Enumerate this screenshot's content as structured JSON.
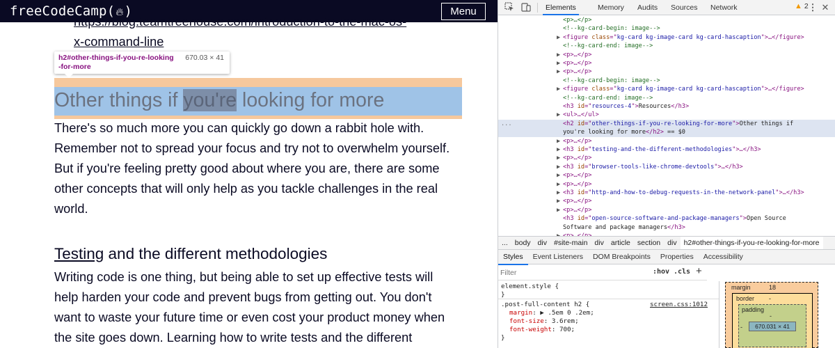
{
  "page": {
    "logo": "freeCodeCamp",
    "logo_paren_open": "(",
    "logo_paren_close": ")",
    "menu_label": "Menu",
    "link_line1": "https://blog.teamtreehouse.com/introduction-to-the-mac-os-",
    "link_line2": "x-command-line",
    "tooltip": {
      "selector_line1": "h2#other-things-if-you-re-looking",
      "selector_line2": "-for-more",
      "dimensions": "670.03 × 41"
    },
    "heading_before": "Other things if ",
    "heading_selected": "you're",
    "heading_after": " looking for more",
    "paragraph1": "There's so much more you can quickly go down a rabbit hole with. Remember not to spread your focus and try not to overwhelm yourself. But if you're feeling pretty good about where you are, there are some other concepts that will only help as you tackle challenges in the real world.",
    "subheading_link": "Testing",
    "subheading_rest": " and the different methodologies",
    "paragraph2": "Writing code is one thing, but being able to set up effective tests will help harden your code and prevent bugs from getting out. You don't want to waste your future time or even cost your product money when the site goes down. Learning how to write tests and the different"
  },
  "devtools": {
    "tabs": [
      "Elements",
      "Memory",
      "Audits",
      "Sources",
      "Network"
    ],
    "active_tab": "Elements",
    "warning_count": "2",
    "dom_lines": [
      {
        "indent": 2,
        "tri": "",
        "parts": [
          [
            "cm",
            "<p>…</p>"
          ]
        ]
      },
      {
        "indent": 2,
        "tri": "",
        "parts": [
          [
            "cm",
            "<!--kg-card-begin: image-->"
          ]
        ]
      },
      {
        "indent": 2,
        "tri": "▶",
        "parts": [
          [
            "tg",
            "<figure "
          ],
          [
            "at",
            "class"
          ],
          [
            "tg",
            "=\""
          ],
          [
            "av",
            "kg-card kg-image-card kg-card-hascaption"
          ],
          [
            "tg",
            "\">…</figure>"
          ]
        ]
      },
      {
        "indent": 2,
        "tri": "",
        "parts": [
          [
            "cm",
            "<!--kg-card-end: image-->"
          ]
        ]
      },
      {
        "indent": 2,
        "tri": "▶",
        "parts": [
          [
            "tg",
            "<p>…</p>"
          ]
        ]
      },
      {
        "indent": 2,
        "tri": "▶",
        "parts": [
          [
            "tg",
            "<p>…</p>"
          ]
        ]
      },
      {
        "indent": 2,
        "tri": "▶",
        "parts": [
          [
            "tg",
            "<p>…</p>"
          ]
        ]
      },
      {
        "indent": 2,
        "tri": "",
        "parts": [
          [
            "cm",
            "<!--kg-card-begin: image-->"
          ]
        ]
      },
      {
        "indent": 2,
        "tri": "▶",
        "parts": [
          [
            "tg",
            "<figure "
          ],
          [
            "at",
            "class"
          ],
          [
            "tg",
            "=\""
          ],
          [
            "av",
            "kg-card kg-image-card kg-card-hascaption"
          ],
          [
            "tg",
            "\">…</figure>"
          ]
        ]
      },
      {
        "indent": 2,
        "tri": "",
        "parts": [
          [
            "cm",
            "<!--kg-card-end: image-->"
          ]
        ]
      },
      {
        "indent": 2,
        "tri": "",
        "parts": [
          [
            "tg",
            "<h3 "
          ],
          [
            "at",
            "id"
          ],
          [
            "tg",
            "=\""
          ],
          [
            "av",
            "resources-4"
          ],
          [
            "tg",
            "\">"
          ],
          [
            "txt",
            "Resources"
          ],
          [
            "tg",
            "</h3>"
          ]
        ]
      },
      {
        "indent": 2,
        "tri": "▶",
        "parts": [
          [
            "tg",
            "<ul>…</ul>"
          ]
        ]
      },
      {
        "indent": 2,
        "tri": "",
        "selected": true,
        "parts": [
          [
            "tg",
            "<h2 "
          ],
          [
            "at",
            "id"
          ],
          [
            "tg",
            "=\""
          ],
          [
            "av",
            "other-things-if-you-re-looking-for-more"
          ],
          [
            "tg",
            "\">"
          ],
          [
            "txt",
            "Other things if"
          ]
        ]
      },
      {
        "indent": 2,
        "tri": "",
        "selected": true,
        "parts": [
          [
            "txt",
            "you're looking for more"
          ],
          [
            "tg",
            "</h2>"
          ],
          [
            "txt",
            " == $0"
          ]
        ]
      },
      {
        "indent": 2,
        "tri": "▶",
        "parts": [
          [
            "tg",
            "<p>…</p>"
          ]
        ]
      },
      {
        "indent": 2,
        "tri": "▶",
        "parts": [
          [
            "tg",
            "<h3 "
          ],
          [
            "at",
            "id"
          ],
          [
            "tg",
            "=\""
          ],
          [
            "av",
            "testing-and-the-different-methodologies"
          ],
          [
            "tg",
            "\">…</h3>"
          ]
        ]
      },
      {
        "indent": 2,
        "tri": "▶",
        "parts": [
          [
            "tg",
            "<p>…</p>"
          ]
        ]
      },
      {
        "indent": 2,
        "tri": "▶",
        "parts": [
          [
            "tg",
            "<h3 "
          ],
          [
            "at",
            "id"
          ],
          [
            "tg",
            "=\""
          ],
          [
            "av",
            "browser-tools-like-chrome-devtools"
          ],
          [
            "tg",
            "\">…</h3>"
          ]
        ]
      },
      {
        "indent": 2,
        "tri": "▶",
        "parts": [
          [
            "tg",
            "<p>…</p>"
          ]
        ]
      },
      {
        "indent": 2,
        "tri": "▶",
        "parts": [
          [
            "tg",
            "<p>…</p>"
          ]
        ]
      },
      {
        "indent": 2,
        "tri": "▶",
        "parts": [
          [
            "tg",
            "<h3 "
          ],
          [
            "at",
            "id"
          ],
          [
            "tg",
            "=\""
          ],
          [
            "av",
            "http-and-how-to-debug-requests-in-the-network-panel"
          ],
          [
            "tg",
            "\">…</h3>"
          ]
        ]
      },
      {
        "indent": 2,
        "tri": "▶",
        "parts": [
          [
            "tg",
            "<p>…</p>"
          ]
        ]
      },
      {
        "indent": 2,
        "tri": "▶",
        "parts": [
          [
            "tg",
            "<p>…</p>"
          ]
        ]
      },
      {
        "indent": 2,
        "tri": "",
        "parts": [
          [
            "tg",
            "<h3 "
          ],
          [
            "at",
            "id"
          ],
          [
            "tg",
            "=\""
          ],
          [
            "av",
            "open-source-software-and-package-managers"
          ],
          [
            "tg",
            "\">"
          ],
          [
            "txt",
            "Open Source"
          ]
        ]
      },
      {
        "indent": 2,
        "tri": "",
        "parts": [
          [
            "txt",
            "Software and package managers"
          ],
          [
            "tg",
            "</h3>"
          ]
        ]
      },
      {
        "indent": 2,
        "tri": "▶",
        "parts": [
          [
            "tg",
            "<p>…</p>"
          ]
        ]
      }
    ],
    "ellipsis": "...",
    "breadcrumbs": [
      "...",
      "body",
      "div",
      "#site-main",
      "div",
      "article",
      "section",
      "div",
      "h2#other-things-if-you-re-looking-for-more"
    ],
    "active_breadcrumb": "h2#other-things-if-you-re-looking-for-more",
    "styles_tabs": [
      "Styles",
      "Event Listeners",
      "DOM Breakpoints",
      "Properties",
      "Accessibility"
    ],
    "active_styles_tab": "Styles",
    "filter_placeholder": "Filter",
    "hov_label": ":hov",
    "cls_label": ".cls",
    "plus_label": "+",
    "element_style": "element.style {",
    "close_brace": "}",
    "rule_selector": ".post-full-content h2 {",
    "rule_source": "screen.css:1012",
    "rule_props": [
      {
        "name": "margin",
        "value": "▶ .5em 0 .2em;"
      },
      {
        "name": "font-size",
        "value": "3.6rem;"
      },
      {
        "name": "font-weight",
        "value": "700;"
      }
    ],
    "box_model": {
      "margin_label": "margin",
      "margin_value": "18",
      "border_label": "border",
      "border_value": "-",
      "padding_label": "padding",
      "padding_value": "-",
      "content": "670.031 × 41",
      "left_value": "-"
    }
  }
}
